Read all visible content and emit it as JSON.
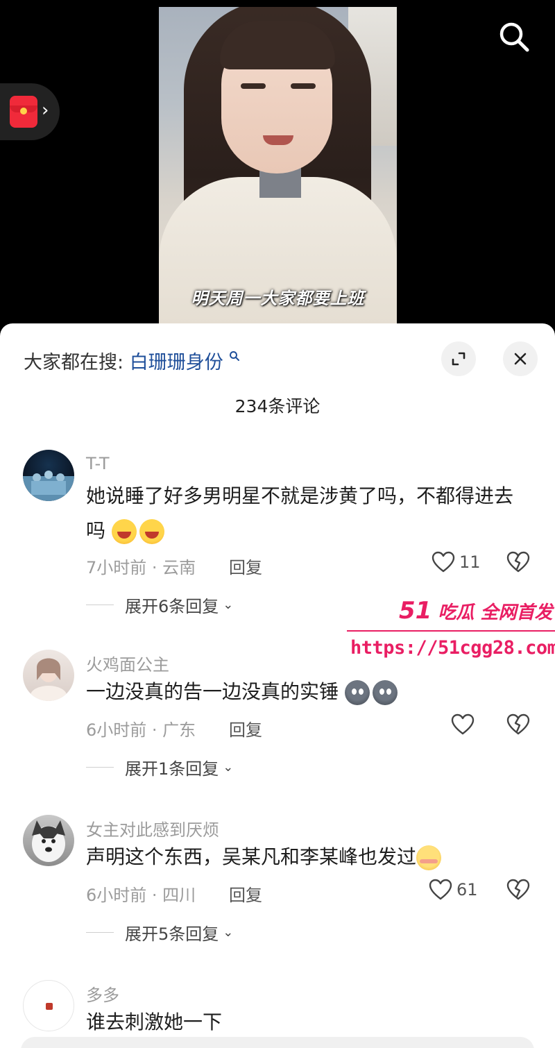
{
  "video": {
    "subtitle": "明天周一大家都要上班"
  },
  "icons": {
    "search": "search-icon",
    "red_packet": "red-packet-icon",
    "expand": "expand-icon",
    "close": "close-icon",
    "like": "heart-icon",
    "dislike": "broken-heart-icon"
  },
  "sheet": {
    "hot_search_prefix": "大家都在搜:",
    "hot_search_keyword": "白珊珊身份",
    "comment_count": "234条评论"
  },
  "comments": [
    {
      "user": "T-T",
      "text": "她说睡了好多男明星不就是涉黄了吗，不都得进去吗",
      "meta": "7小时前 · 云南",
      "reply_label": "回复",
      "likes": "11",
      "expand_label": "展开6条回复"
    },
    {
      "user": "火鸡面公主",
      "text": "一边没真的告一边没真的实锤",
      "meta": "6小时前 · 广东",
      "reply_label": "回复",
      "likes": "",
      "expand_label": "展开1条回复"
    },
    {
      "user": "女主对此感到厌烦",
      "text": "声明这个东西，吴某凡和李某峰也发过",
      "meta": "6小时前 · 四川",
      "reply_label": "回复",
      "likes": "61",
      "expand_label": "展开5条回复"
    },
    {
      "user": "多多",
      "text": "谁去刺激她一下",
      "meta": "",
      "reply_label": "",
      "likes": "",
      "expand_label": ""
    }
  ],
  "watermark": {
    "brand": "吃瓜 全网首发",
    "number": "51",
    "url": "https://51cgg28.com"
  },
  "colors": {
    "keyword": "#1f4f9a",
    "watermark": "#e91e63",
    "red_packet": "#f02a3a"
  }
}
